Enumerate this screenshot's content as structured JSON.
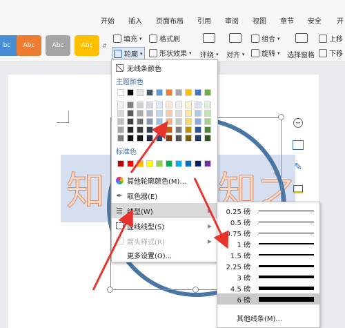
{
  "tabs": [
    "开始",
    "插入",
    "页面布局",
    "引用",
    "审阅",
    "视图",
    "章节",
    "安全",
    "开"
  ],
  "style_buttons": [
    {
      "label": "bc",
      "color": "#4a8fd6"
    },
    {
      "label": "Abc",
      "color": "#ee7d31"
    },
    {
      "label": "Abc",
      "color": "#a5a5a5"
    },
    {
      "label": "Abc",
      "color": "#ffc000"
    }
  ],
  "ribbon": {
    "fill": "填充",
    "format_brush": "格式刷",
    "outline": "轮廓",
    "shape_effect": "形状效果",
    "wrap": "环绕",
    "align": "对齐",
    "group": "组合",
    "rotate": "旋转",
    "selection_pane": "选择窗格",
    "move_up": "上移",
    "move_down": "下移"
  },
  "art_text": {
    "left": "知",
    "right": "知之"
  },
  "menu": {
    "no_line": "无线条颜色",
    "theme_colors": "主题颜色",
    "standard_colors": "标准色",
    "other_colors": "其他轮廓颜色(M)...",
    "eyedropper": "取色器(E)",
    "line_type": "线型(W)",
    "dash_type": "虚线线型(S)",
    "arrow_style": "箭头样式(R)",
    "more_settings": "更多设置(O)..."
  },
  "theme_top": [
    "#ffffff",
    "#000000",
    "#e7e6e6",
    "#44546a",
    "#5b9bd5",
    "#ed7d31",
    "#a5a5a5",
    "#ffc000",
    "#4472c4",
    "#70ad47"
  ],
  "theme_shades": [
    [
      "#f2f2f2",
      "#7f7f7f",
      "#d0cece",
      "#d6dce4",
      "#deebf6",
      "#fbe5d5",
      "#ededed",
      "#fff2cc",
      "#d9e2f3",
      "#e2efd9"
    ],
    [
      "#d8d8d8",
      "#595959",
      "#aeabab",
      "#adb9ca",
      "#bdd7ee",
      "#f7cbac",
      "#dbdbdb",
      "#fee599",
      "#b4c6e7",
      "#c5e0b3"
    ],
    [
      "#bfbfbf",
      "#3f3f3f",
      "#757070",
      "#8496b0",
      "#9cc3e5",
      "#f4b183",
      "#c9c9c9",
      "#ffd965",
      "#8eaadb",
      "#a8d08d"
    ],
    [
      "#a5a5a5",
      "#262626",
      "#3a3838",
      "#323f4f",
      "#2e75b5",
      "#c55a11",
      "#7b7b7b",
      "#bf9000",
      "#2f5496",
      "#538135"
    ],
    [
      "#7f7f7f",
      "#0c0c0c",
      "#171616",
      "#222a35",
      "#1e4e79",
      "#833c0b",
      "#525252",
      "#7f6000",
      "#1f3864",
      "#375623"
    ]
  ],
  "standard": [
    "#c00000",
    "#ff0000",
    "#ffc000",
    "#ffff00",
    "#92d050",
    "#00b050",
    "#00b0f0",
    "#0070c0",
    "#002060",
    "#7030a0"
  ],
  "line_weights": [
    {
      "label": "0.25 磅",
      "w": 0.5
    },
    {
      "label": "0.5 磅",
      "w": 1
    },
    {
      "label": "0.75 磅",
      "w": 1
    },
    {
      "label": "1 磅",
      "w": 1.5
    },
    {
      "label": "1.5 磅",
      "w": 2
    },
    {
      "label": "2.25 磅",
      "w": 3
    },
    {
      "label": "3 磅",
      "w": 4
    },
    {
      "label": "4.5 磅",
      "w": 5
    },
    {
      "label": "6 磅",
      "w": 7
    }
  ],
  "other_lines": "其他线条(M)..."
}
